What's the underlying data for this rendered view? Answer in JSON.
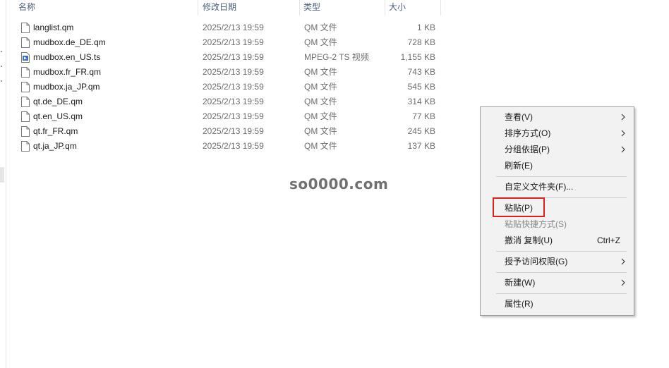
{
  "columns": {
    "name": "名称",
    "date_modified": "修改日期",
    "type": "类型",
    "size": "大小"
  },
  "files": [
    {
      "name": "langlist.qm",
      "date": "2025/2/13 19:59",
      "type": "QM 文件",
      "size": "1 KB",
      "icon": "document-icon"
    },
    {
      "name": "mudbox.de_DE.qm",
      "date": "2025/2/13 19:59",
      "type": "QM 文件",
      "size": "728 KB",
      "icon": "document-icon"
    },
    {
      "name": "mudbox.en_US.ts",
      "date": "2025/2/13 19:59",
      "type": "MPEG-2 TS 视频",
      "size": "1,155 KB",
      "icon": "video-file-icon"
    },
    {
      "name": "mudbox.fr_FR.qm",
      "date": "2025/2/13 19:59",
      "type": "QM 文件",
      "size": "743 KB",
      "icon": "document-icon"
    },
    {
      "name": "mudbox.ja_JP.qm",
      "date": "2025/2/13 19:59",
      "type": "QM 文件",
      "size": "545 KB",
      "icon": "document-icon"
    },
    {
      "name": "qt.de_DE.qm",
      "date": "2025/2/13 19:59",
      "type": "QM 文件",
      "size": "314 KB",
      "icon": "document-icon"
    },
    {
      "name": "qt.en_US.qm",
      "date": "2025/2/13 19:59",
      "type": "QM 文件",
      "size": "77 KB",
      "icon": "document-icon"
    },
    {
      "name": "qt.fr_FR.qm",
      "date": "2025/2/13 19:59",
      "type": "QM 文件",
      "size": "245 KB",
      "icon": "document-icon"
    },
    {
      "name": "qt.ja_JP.qm",
      "date": "2025/2/13 19:59",
      "type": "QM 文件",
      "size": "137 KB",
      "icon": "document-icon"
    }
  ],
  "watermark": "so0000.com",
  "context_menu": {
    "view": "查看(V)",
    "sort_by": "排序方式(O)",
    "group_by": "分组依据(P)",
    "refresh": "刷新(E)",
    "customize_folder": "自定义文件夹(F)...",
    "paste": "粘贴(P)",
    "paste_shortcut": "粘贴快捷方式(S)",
    "undo_copy": "撤消 复制(U)",
    "undo_shortcut": "Ctrl+Z",
    "give_access": "授予访问权限(G)",
    "new": "新建(W)",
    "properties": "属性(R)"
  },
  "colors": {
    "highlight_border": "#e02020",
    "menu_background": "#f2f2f2"
  }
}
